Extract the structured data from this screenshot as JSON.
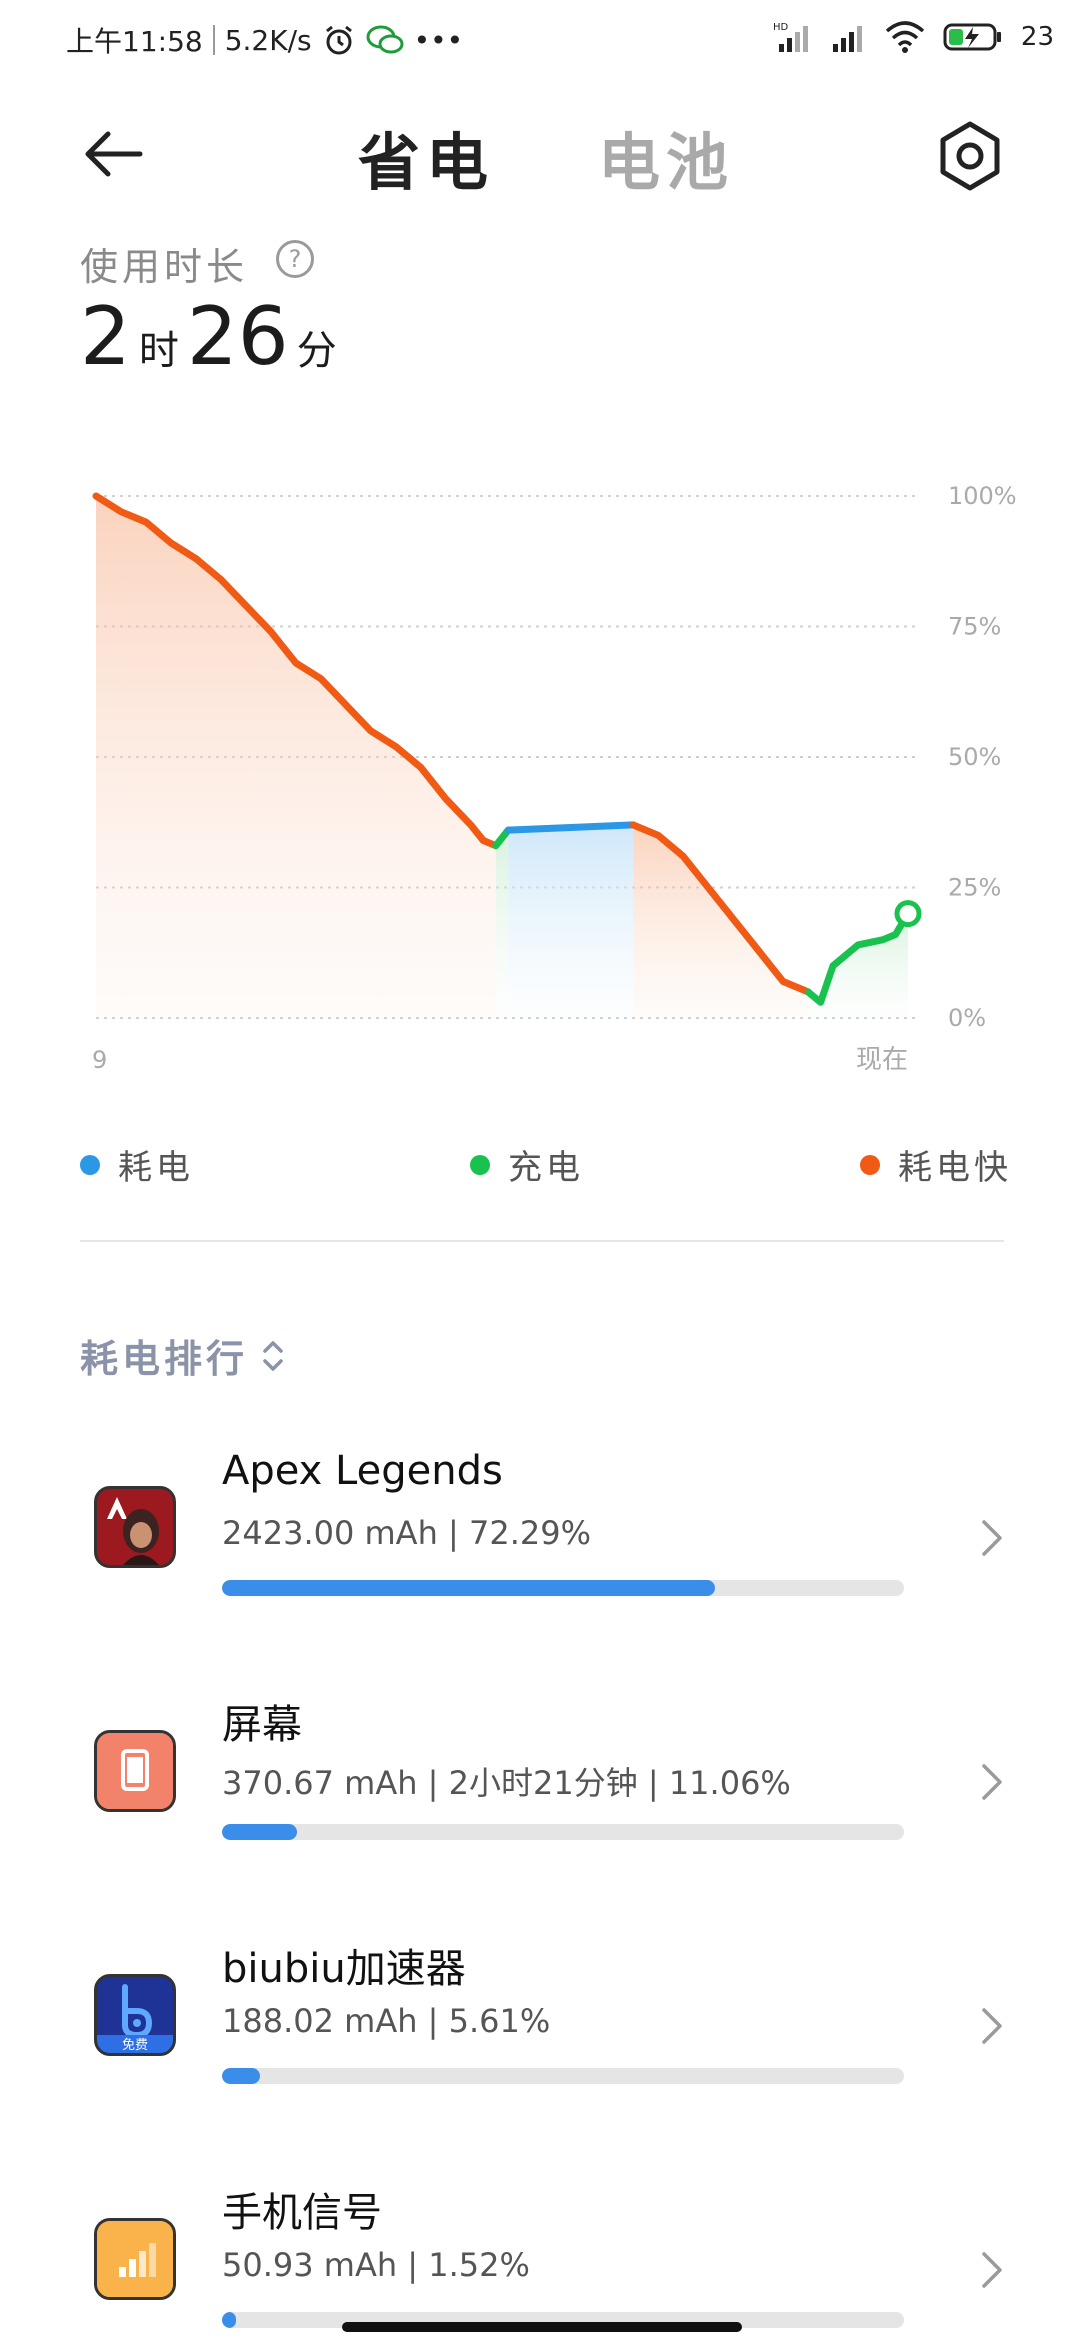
{
  "status_bar": {
    "time": "上午11:58",
    "speed": "5.2K/s",
    "more": "•••",
    "battery": "23"
  },
  "header": {
    "tab_active": "省电",
    "tab_inactive": "电池"
  },
  "usage": {
    "label": "使用时长",
    "help": "?",
    "hours": "2",
    "hours_unit": "时",
    "minutes": "26",
    "minutes_unit": "分"
  },
  "chart_data": {
    "type": "line",
    "title": "",
    "x_start_label": "9",
    "x_end_label": "现在",
    "y_ticks": [
      "100%",
      "75%",
      "50%",
      "25%",
      "0%"
    ],
    "ylim": [
      0,
      100
    ],
    "grid": true,
    "series": [
      {
        "name": "耗电快",
        "color": "#f05a14",
        "points": [
          [
            0,
            100
          ],
          [
            2,
            97
          ],
          [
            4,
            95
          ],
          [
            6,
            91
          ],
          [
            8,
            88
          ],
          [
            10,
            84
          ],
          [
            12,
            79
          ],
          [
            14,
            74
          ],
          [
            16,
            68
          ],
          [
            18,
            65
          ],
          [
            20,
            60
          ],
          [
            22,
            55
          ],
          [
            24,
            52
          ],
          [
            26,
            48
          ],
          [
            28,
            42
          ],
          [
            30,
            37
          ],
          [
            31,
            34
          ],
          [
            32,
            33
          ]
        ]
      },
      {
        "name": "充电",
        "color": "#19c24f",
        "points": [
          [
            32,
            33
          ],
          [
            33,
            36
          ]
        ]
      },
      {
        "name": "耗电",
        "color": "#2b98e6",
        "points": [
          [
            33,
            36
          ],
          [
            43,
            37
          ]
        ]
      },
      {
        "name": "耗电快",
        "color": "#f05a14",
        "points": [
          [
            43,
            37
          ],
          [
            45,
            35
          ],
          [
            47,
            31
          ],
          [
            49,
            25
          ],
          [
            51,
            19
          ],
          [
            53,
            13
          ],
          [
            55,
            7
          ],
          [
            57,
            5
          ]
        ]
      },
      {
        "name": "充电",
        "color": "#19c24f",
        "points": [
          [
            57,
            5
          ],
          [
            58,
            3
          ],
          [
            59,
            10
          ],
          [
            61,
            14
          ],
          [
            63,
            15
          ],
          [
            64,
            16
          ],
          [
            65,
            20
          ]
        ]
      }
    ]
  },
  "legend": [
    {
      "label": "耗电",
      "color": "#2b98e6"
    },
    {
      "label": "充电",
      "color": "#19c24f"
    },
    {
      "label": "耗电快",
      "color": "#f05a14"
    }
  ],
  "ranking": {
    "title": "耗电排行",
    "items": [
      {
        "name": "Apex Legends",
        "stat": "2423.00 mAh | 72.29%",
        "percent": 72.29,
        "icon": "apex-legends-icon"
      },
      {
        "name": "屏幕",
        "stat": "370.67 mAh | 2小时21分钟 | 11.06%",
        "percent": 11.06,
        "icon": "screen-icon"
      },
      {
        "name": "biubiu加速器",
        "stat": "188.02 mAh | 5.61%",
        "percent": 5.61,
        "icon": "biubiu-icon",
        "badge": "免费"
      },
      {
        "name": "手机信号",
        "stat": "50.93 mAh | 1.52%",
        "percent": 1.52,
        "icon": "signal-icon"
      }
    ]
  }
}
